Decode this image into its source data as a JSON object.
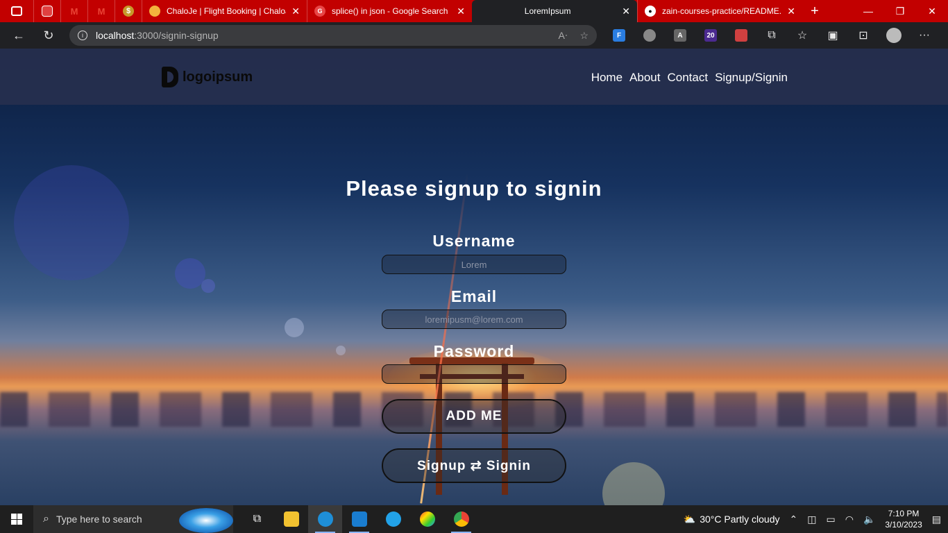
{
  "browser": {
    "tabs": [
      {
        "title": "ChaloJe | Flight Booking | ChaloJe",
        "favicon": "chaloje-icon"
      },
      {
        "title": "splice() in json - Google Search",
        "favicon": "google-icon"
      },
      {
        "title": "LoremIpsum",
        "favicon": "",
        "active": true
      },
      {
        "title": "zain-courses-practice/README.md",
        "favicon": "github-icon"
      }
    ],
    "pinned": [
      "app-icon",
      "gmail-icon",
      "gmail-icon",
      "coin-icon"
    ],
    "address": {
      "host": "localhost",
      "path": ":3000/signin-signup"
    },
    "tabbar_color": "#c20000",
    "extension_badge": "20"
  },
  "site": {
    "logo": "logoipsum",
    "nav": [
      "Home",
      "About",
      "Contact",
      "Signup/Signin"
    ],
    "heading": "Please signup to signin",
    "form": {
      "username_label": "Username",
      "username_placeholder": "Lorem",
      "email_label": "Email",
      "email_placeholder": "loremipusm@lorem.com",
      "password_label": "Password",
      "password_placeholder": "",
      "add_button": "ADD ME",
      "switch_button": "Signup ⇄ Signin"
    }
  },
  "taskbar": {
    "search_placeholder": "Type here to search",
    "weather": "30°C  Partly cloudy",
    "time": "7:10 PM",
    "date": "3/10/2023"
  }
}
